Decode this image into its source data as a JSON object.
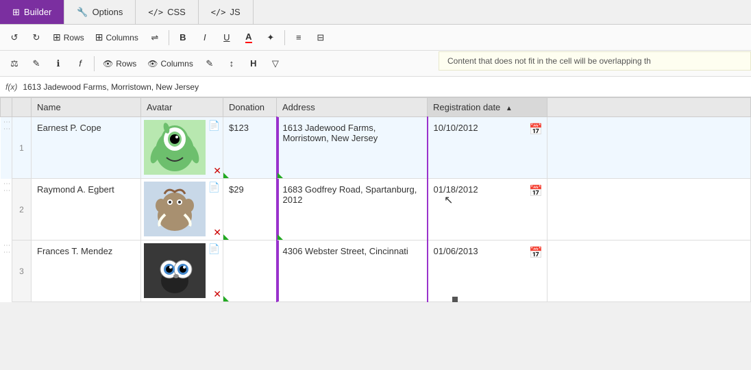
{
  "tabs": [
    {
      "id": "builder",
      "label": "Builder",
      "icon": "⊞",
      "active": true
    },
    {
      "id": "options",
      "label": "Options",
      "icon": "🔧",
      "active": false
    },
    {
      "id": "css",
      "label": "CSS",
      "icon": "</>",
      "active": false
    },
    {
      "id": "js",
      "label": "JS",
      "icon": "</>",
      "active": false
    }
  ],
  "toolbar1": {
    "buttons": [
      {
        "id": "undo",
        "icon": "↺",
        "label": ""
      },
      {
        "id": "redo",
        "icon": "↻",
        "label": ""
      },
      {
        "id": "rows",
        "icon": "⊞",
        "label": "Rows"
      },
      {
        "id": "columns",
        "icon": "⊞",
        "label": "Columns"
      },
      {
        "id": "transfer",
        "icon": "⇌",
        "label": ""
      },
      {
        "id": "bold",
        "icon": "B",
        "label": ""
      },
      {
        "id": "italic",
        "icon": "I",
        "label": ""
      },
      {
        "id": "underline",
        "icon": "U",
        "label": ""
      },
      {
        "id": "font-color",
        "icon": "A",
        "label": ""
      },
      {
        "id": "highlight",
        "icon": "✦",
        "label": ""
      },
      {
        "id": "align",
        "icon": "≡",
        "label": ""
      },
      {
        "id": "border",
        "icon": "⊟",
        "label": ""
      }
    ],
    "tooltip": "Content that does not fit in the cell will be overlapping th"
  },
  "toolbar2": {
    "buttons": [
      {
        "id": "scale",
        "icon": "⚖",
        "label": ""
      },
      {
        "id": "edit",
        "icon": "✎",
        "label": ""
      },
      {
        "id": "info",
        "icon": "ℹ",
        "label": ""
      },
      {
        "id": "func",
        "icon": "f",
        "label": ""
      },
      {
        "id": "rows2",
        "icon": "⊞",
        "label": "Rows"
      },
      {
        "id": "columns2",
        "icon": "⊞",
        "label": "Columns"
      },
      {
        "id": "edit2",
        "icon": "✎",
        "label": ""
      },
      {
        "id": "sort",
        "icon": "↕",
        "label": ""
      },
      {
        "id": "header",
        "icon": "H",
        "label": ""
      },
      {
        "id": "filter",
        "icon": "▽",
        "label": ""
      }
    ]
  },
  "formula_bar": {
    "label": "f(x)",
    "value": "1613 Jadewood Farms, Morristown, New Jersey"
  },
  "table": {
    "columns": [
      {
        "id": "name",
        "label": "Name"
      },
      {
        "id": "avatar",
        "label": "Avatar"
      },
      {
        "id": "donation",
        "label": "Donation"
      },
      {
        "id": "address",
        "label": "Address"
      },
      {
        "id": "reg_date",
        "label": "Registration date",
        "sorted": true,
        "sort_dir": "▲"
      }
    ],
    "rows": [
      {
        "num": 1,
        "name": "Earnest P. Cope",
        "avatar_bg": "green",
        "avatar_emoji": "👾",
        "donation": "$123",
        "address": "1613 Jadewood Farms, Morristown, New Jersey",
        "reg_date": "10/10/2012"
      },
      {
        "num": 2,
        "name": "Raymond A. Egbert",
        "avatar_bg": "blue",
        "avatar_emoji": "🦣",
        "donation": "$29",
        "address": "1683 Godfrey Road, Spartanburg, 2012",
        "reg_date": "01/18/2012"
      },
      {
        "num": 3,
        "name": "Frances T. Mendez",
        "avatar_bg": "dark",
        "avatar_emoji": "👁",
        "donation": "",
        "address": "4306 Webster Street, Cincinnati",
        "reg_date": "01/06/2013"
      }
    ]
  }
}
